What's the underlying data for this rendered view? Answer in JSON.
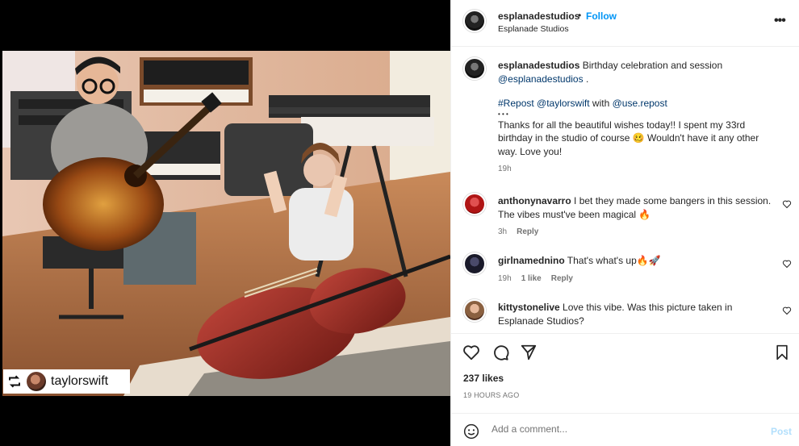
{
  "post": {
    "photo_repost_user": "taylorswift"
  },
  "header": {
    "username": "esplanadestudios",
    "dot": "•",
    "follow_label": "Follow",
    "location": "Esplanade Studios",
    "more": "•••"
  },
  "caption": {
    "username": "esplanadestudios",
    "line1": "Birthday celebration and session",
    "mention": "@esplanadestudios",
    "period": ".",
    "repost_tag": "#Repost @taylorswift",
    "with": "with",
    "repost_app": "@use.repost",
    "dots": "• • •",
    "text": "Thanks for all the beautiful wishes today!! I spent my 33rd birthday in the studio of course 🥴 Wouldn't have it any other way. Love you!",
    "time": "19h"
  },
  "comments": [
    {
      "username": "anthonynavarro",
      "text": "I bet they made some bangers in this session. The vibes must've been magical 🔥",
      "time": "3h",
      "likes": "",
      "reply": "Reply"
    },
    {
      "username": "girlnamednino",
      "text": "That's what's up🔥🚀",
      "time": "19h",
      "likes": "1 like",
      "reply": "Reply"
    },
    {
      "username": "kittystonelive",
      "text": "Love this vibe. Was this picture taken in Esplanade Studios?",
      "time": "",
      "likes": "",
      "reply": ""
    }
  ],
  "stats": {
    "likes": "237 likes",
    "timestamp": "19 HOURS AGO"
  },
  "composer": {
    "placeholder": "Add a comment...",
    "post_label": "Post"
  },
  "icons": {
    "like": "heart-icon",
    "comment": "comment-icon",
    "share": "send-icon",
    "save": "bookmark-icon",
    "emoji": "emoji-icon",
    "more": "more-icon",
    "repost": "repost-icon"
  },
  "colors": {
    "follow": "#0095f6",
    "link": "#00376b",
    "muted": "#737373",
    "post_disabled": "#b2dffc"
  }
}
